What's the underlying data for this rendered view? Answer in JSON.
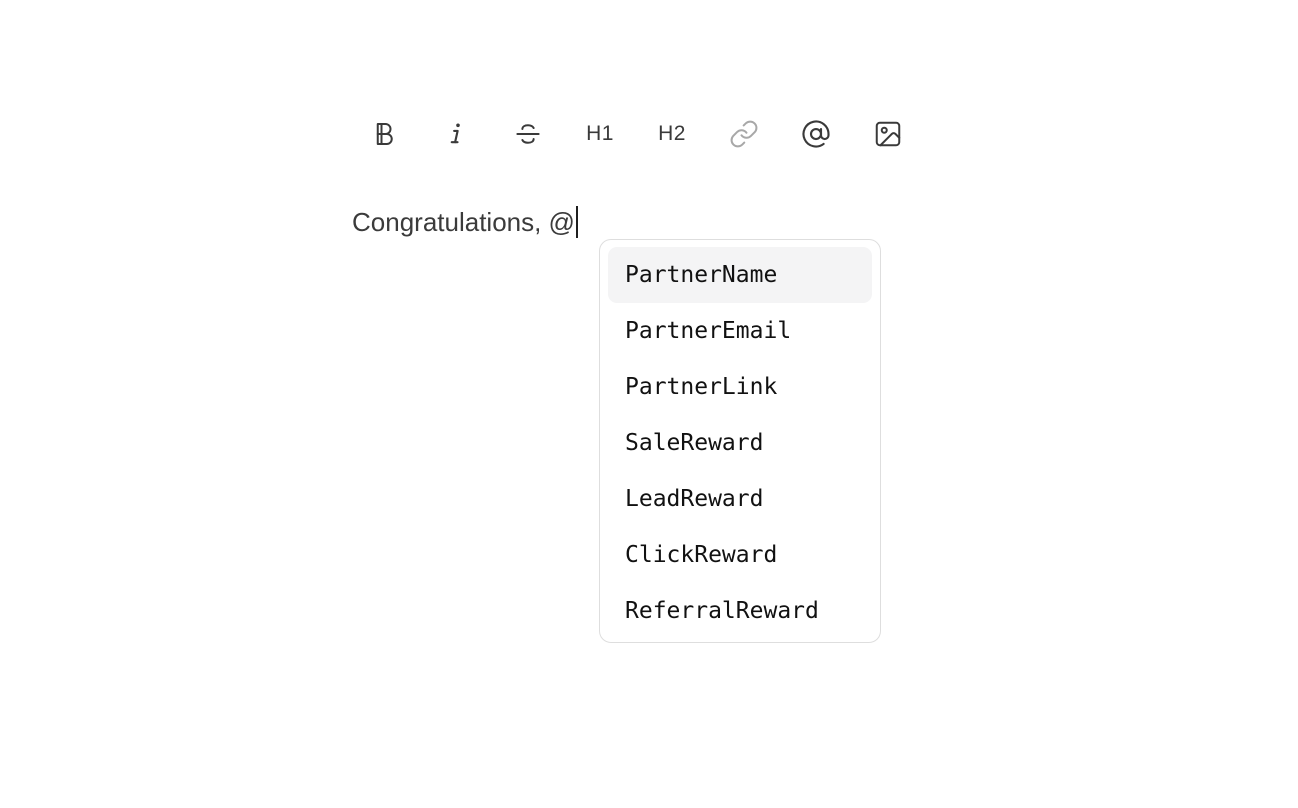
{
  "toolbar": {
    "buttons": [
      {
        "id": "bold",
        "icon": "bold-icon",
        "label": ""
      },
      {
        "id": "italic",
        "icon": "italic-icon",
        "label": ""
      },
      {
        "id": "strike",
        "icon": "strikethrough-icon",
        "label": ""
      },
      {
        "id": "h1",
        "icon": "",
        "label": "H1"
      },
      {
        "id": "h2",
        "icon": "",
        "label": "H2"
      },
      {
        "id": "link",
        "icon": "link-icon",
        "label": "",
        "disabled": true
      },
      {
        "id": "mention",
        "icon": "at-sign-icon",
        "label": ""
      },
      {
        "id": "image",
        "icon": "image-icon",
        "label": ""
      }
    ]
  },
  "editor": {
    "text": "Congratulations, @"
  },
  "dropdown": {
    "active_index": 0,
    "items": [
      {
        "label": "PartnerName"
      },
      {
        "label": "PartnerEmail"
      },
      {
        "label": "PartnerLink"
      },
      {
        "label": "SaleReward"
      },
      {
        "label": "LeadReward"
      },
      {
        "label": "ClickReward"
      },
      {
        "label": "ReferralReward"
      }
    ]
  },
  "colors": {
    "icon": "#3a3a3a",
    "icon_disabled": "#a8a8a8",
    "text": "#3b3b3b",
    "active_item_bg": "#f4f4f5",
    "dropdown_border": "#dedede"
  }
}
